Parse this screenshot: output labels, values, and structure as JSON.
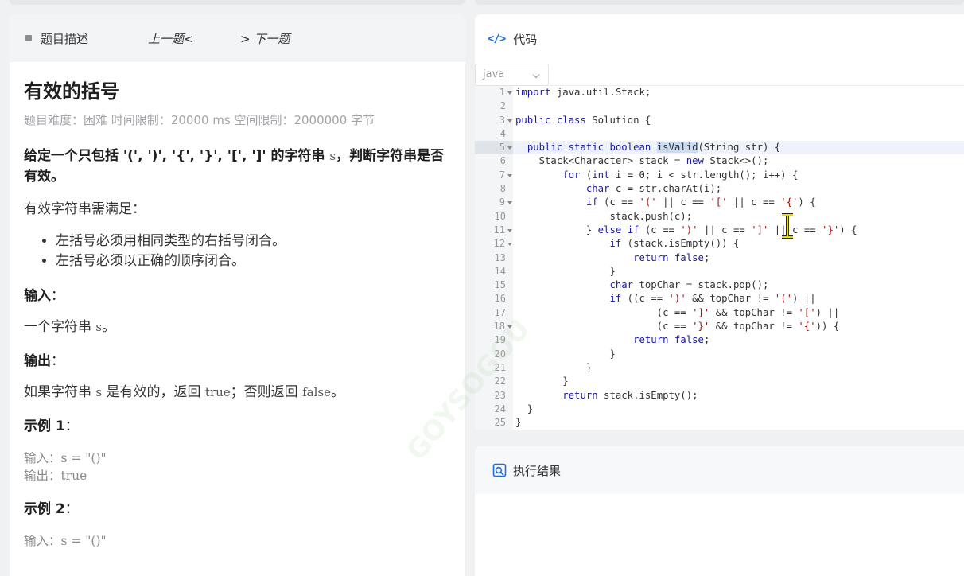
{
  "left": {
    "tab_label": "题目描述",
    "prev_label": "上一题<",
    "next_label": "> 下一题",
    "title": "有效的括号",
    "meta": "题目难度：困难 时间限制：20000 ms 空间限制：2000000 字节",
    "desc_before": "给定一个只包括 '(', ')', '{', '}', '[', ']' 的字符串 ",
    "desc_var": "s",
    "desc_after": "，判断字符串是否有效。",
    "valid_intro": "有效字符串需满足：",
    "rules": [
      "左括号必须用相同类型的右括号闭合。",
      "左括号必须以正确的顺序闭合。"
    ],
    "input_heading": "输入",
    "input_text_before": "一个字符串 ",
    "input_text_var": "s",
    "input_text_after": "。",
    "output_heading": "输出",
    "output_before": "如果字符串 ",
    "output_var": "s",
    "output_mid": " 是有效的，返回 ",
    "output_true": "true",
    "output_mid2": "；否则返回 ",
    "output_false": "false",
    "output_after": "。",
    "example1_heading": "示例 1",
    "example1_input": "输入：s = \"()\"",
    "example1_output": "输出：true",
    "example2_heading": "示例 2",
    "example2_input": "输入：s = \"()\""
  },
  "code": {
    "tab_label": "代码",
    "icon": "</>",
    "language": "java",
    "line_numbers": [
      "1",
      "2",
      "3",
      "4",
      "5",
      "6",
      "7",
      "8",
      "9",
      "10",
      "11",
      "12",
      "13",
      "14",
      "15",
      "16",
      "17",
      "18",
      "19",
      "20",
      "21",
      "22",
      "23",
      "24",
      "25"
    ],
    "lines": [
      "import java.util.Stack;",
      "",
      "public class Solution {",
      "",
      "  public static boolean isValid(String str) {",
      "    Stack<Character> stack = new Stack<>();",
      "        for (int i = 0; i < str.length(); i++) {",
      "            char c = str.charAt(i);",
      "            if (c == '(' || c == '[' || c == '{') {",
      "                stack.push(c);",
      "            } else if (c == ')' || c == ']' || c == '}') {",
      "                if (stack.isEmpty()) {",
      "                    return false;",
      "                }",
      "                char topChar = stack.pop();",
      "                if ((c == ')' && topChar != '(') ||",
      "                        (c == ']' && topChar != '[') ||",
      "                        (c == '}' && topChar != '{')) {",
      "                    return false;",
      "                }",
      "            }",
      "        }",
      "        return stack.isEmpty();",
      "  }",
      "}"
    ]
  },
  "result": {
    "tab_label": "执行结果"
  },
  "watermark": "GOYSOGOU"
}
